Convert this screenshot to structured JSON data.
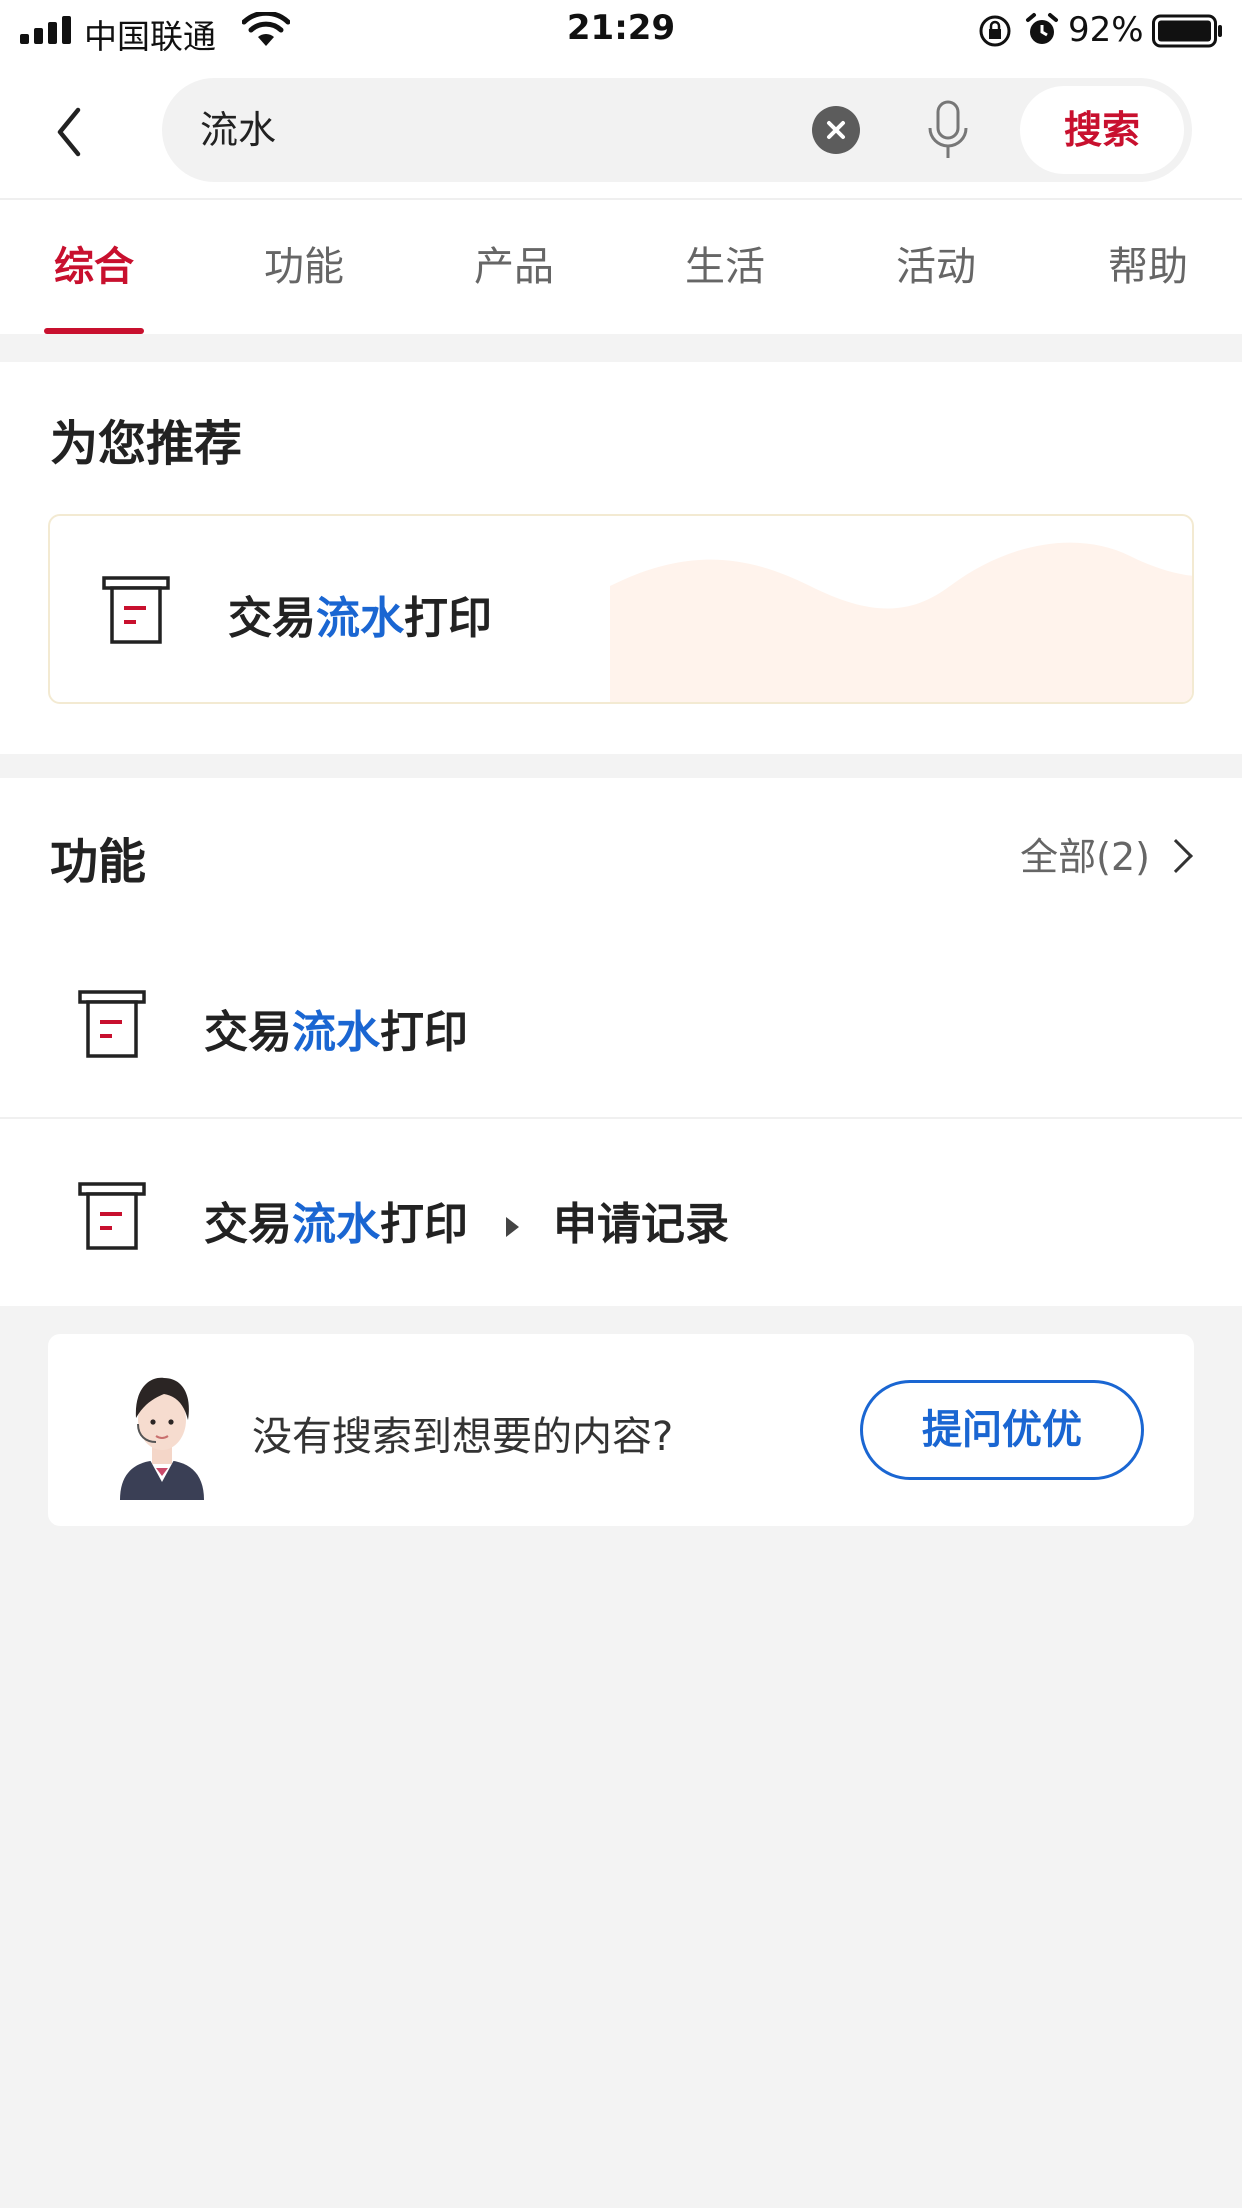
{
  "status_bar": {
    "carrier": "中国联通",
    "time": "21:29",
    "battery": "92%",
    "battery_level": 0.92
  },
  "search": {
    "query": "流水",
    "button_label": "搜索"
  },
  "tabs": [
    {
      "label": "综合",
      "active": true
    },
    {
      "label": "功能",
      "active": false
    },
    {
      "label": "产品",
      "active": false
    },
    {
      "label": "生活",
      "active": false
    },
    {
      "label": "活动",
      "active": false
    },
    {
      "label": "帮助",
      "active": false
    }
  ],
  "recommend": {
    "title": "为您推荐",
    "item": {
      "prefix": "交易",
      "highlight": "流水",
      "suffix": "打印"
    }
  },
  "functions": {
    "title": "功能",
    "all_label": "全部(2)",
    "items": [
      {
        "prefix": "交易",
        "highlight": "流水",
        "suffix": "打印"
      },
      {
        "prefix": "交易",
        "highlight": "流水",
        "suffix": "打印",
        "sub": "申请记录"
      }
    ]
  },
  "ask": {
    "text": "没有搜索到想要的内容?",
    "button_label": "提问优优"
  },
  "colors": {
    "brand": "#c8102e",
    "highlight": "#1a66d2"
  }
}
